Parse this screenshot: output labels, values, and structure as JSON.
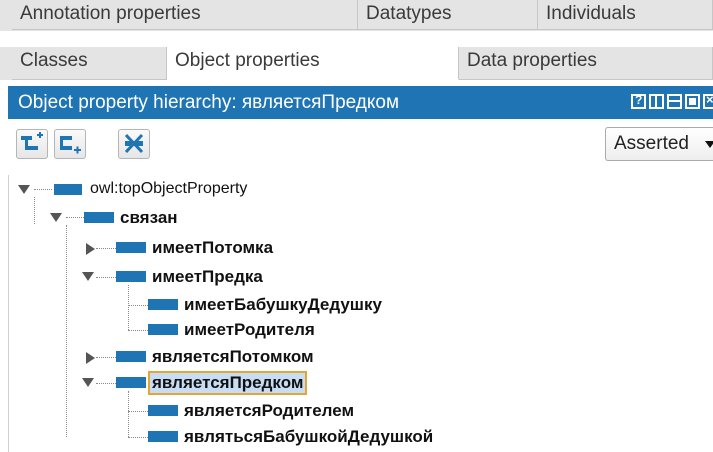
{
  "tabs_row1": [
    {
      "label": "Annotation properties"
    },
    {
      "label": "Datatypes"
    },
    {
      "label": "Individuals"
    }
  ],
  "tabs_row2": [
    {
      "label": "Classes"
    },
    {
      "label": "Object properties"
    },
    {
      "label": "Data properties"
    }
  ],
  "panel": {
    "title": "Object property hierarchy: являетсяПредком"
  },
  "toolbar": {
    "add_subproperty_icon": "add-sub-property-icon",
    "add_sibling_icon": "add-sibling-property-icon",
    "delete_icon": "delete-property-icon",
    "view_mode": "Asserted"
  },
  "tree": {
    "root": "owl:topObjectProperty",
    "n1": "связан",
    "n2": "имеетПотомка",
    "n3": "имеетПредка",
    "n4": "имеетБабушкуДедушку",
    "n5": "имеетРодителя",
    "n6": "являетсяПотомком",
    "n7": "являетсяПредком",
    "n8": "являетсяРодителем",
    "n9": "являтьсяБабушкойДедушкой"
  },
  "colors": {
    "accent": "#1f74b4",
    "selection_border": "#e2a637"
  }
}
